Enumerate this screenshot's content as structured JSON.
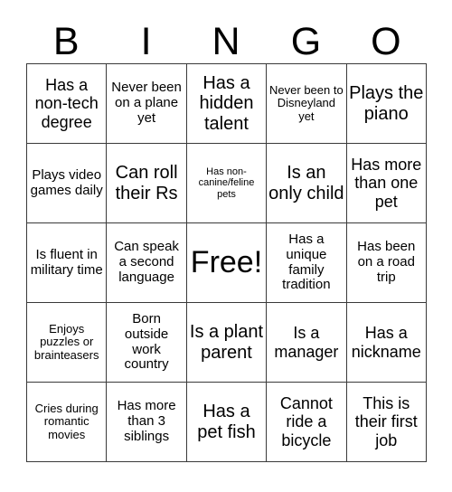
{
  "card": {
    "header_letters": [
      "B",
      "I",
      "N",
      "G",
      "O"
    ],
    "rows": [
      [
        {
          "text": "Has a non-tech degree",
          "size": "lg"
        },
        {
          "text": "Never been on a plane yet",
          "size": "md"
        },
        {
          "text": "Has a hidden talent",
          "size": "xl"
        },
        {
          "text": "Never been to Disneyland yet",
          "size": "sm"
        },
        {
          "text": "Plays the piano",
          "size": "xl"
        }
      ],
      [
        {
          "text": "Plays video games daily",
          "size": "md"
        },
        {
          "text": "Can roll their Rs",
          "size": "xl"
        },
        {
          "text": "Has non-canine/feline pets",
          "size": "xs"
        },
        {
          "text": "Is an only child",
          "size": "xl"
        },
        {
          "text": "Has more than one pet",
          "size": "lg"
        }
      ],
      [
        {
          "text": "Is fluent in military time",
          "size": "md"
        },
        {
          "text": "Can speak a second language",
          "size": "md"
        },
        {
          "text": "Free!",
          "size": "free"
        },
        {
          "text": "Has a unique family tradition",
          "size": "md"
        },
        {
          "text": "Has been on a road trip",
          "size": "md"
        }
      ],
      [
        {
          "text": "Enjoys puzzles or brainteasers",
          "size": "sm"
        },
        {
          "text": "Born outside work country",
          "size": "md"
        },
        {
          "text": "Is a plant parent",
          "size": "xl"
        },
        {
          "text": "Is a manager",
          "size": "lg"
        },
        {
          "text": "Has a nickname",
          "size": "lg"
        }
      ],
      [
        {
          "text": "Cries during romantic movies",
          "size": "sm"
        },
        {
          "text": "Has more than 3 siblings",
          "size": "md"
        },
        {
          "text": "Has a pet fish",
          "size": "xl"
        },
        {
          "text": "Cannot ride a bicycle",
          "size": "lg"
        },
        {
          "text": "This is their first job",
          "size": "lg"
        }
      ]
    ]
  }
}
